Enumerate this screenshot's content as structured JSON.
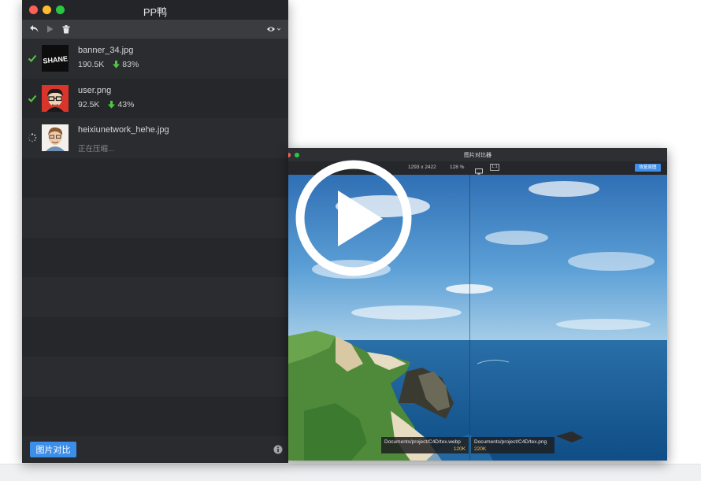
{
  "app": {
    "title": "PP鸭",
    "toolbar": {
      "undo_icon": "undo-icon",
      "play_icon": "play-icon",
      "trash_icon": "trash-icon",
      "view_icon": "eye-icon"
    },
    "files": [
      {
        "name": "banner_34.jpg",
        "status": "done",
        "size": "190.5K",
        "saved": "83%",
        "thumb_text": "SHANE"
      },
      {
        "name": "user.png",
        "status": "done",
        "size": "92.5K",
        "saved": "43%"
      },
      {
        "name": "heixiunetwork_hehe.jpg",
        "status": "pending",
        "pending_text": "正在压缩..."
      }
    ],
    "footer": {
      "compare_button": "图片对比",
      "info_icon": "info-icon"
    }
  },
  "compare_window": {
    "title": "图片对比器",
    "dimensions": "1293 x 2422",
    "zoom": "128 %",
    "one_to_one": "1:1",
    "button": "恢复原图",
    "left": {
      "path": "Documents/project/C4D/tex.webp",
      "size": "120K"
    },
    "right": {
      "path": "Documents/project/C4D/tex.png",
      "size": "220K"
    }
  },
  "overlay": {
    "play_icon": "play-circle-icon"
  },
  "colors": {
    "accent": "#3d8ee8",
    "success": "#4cc93f",
    "panel": "#2a2b2f",
    "saved_tag": "#f0c24a"
  }
}
